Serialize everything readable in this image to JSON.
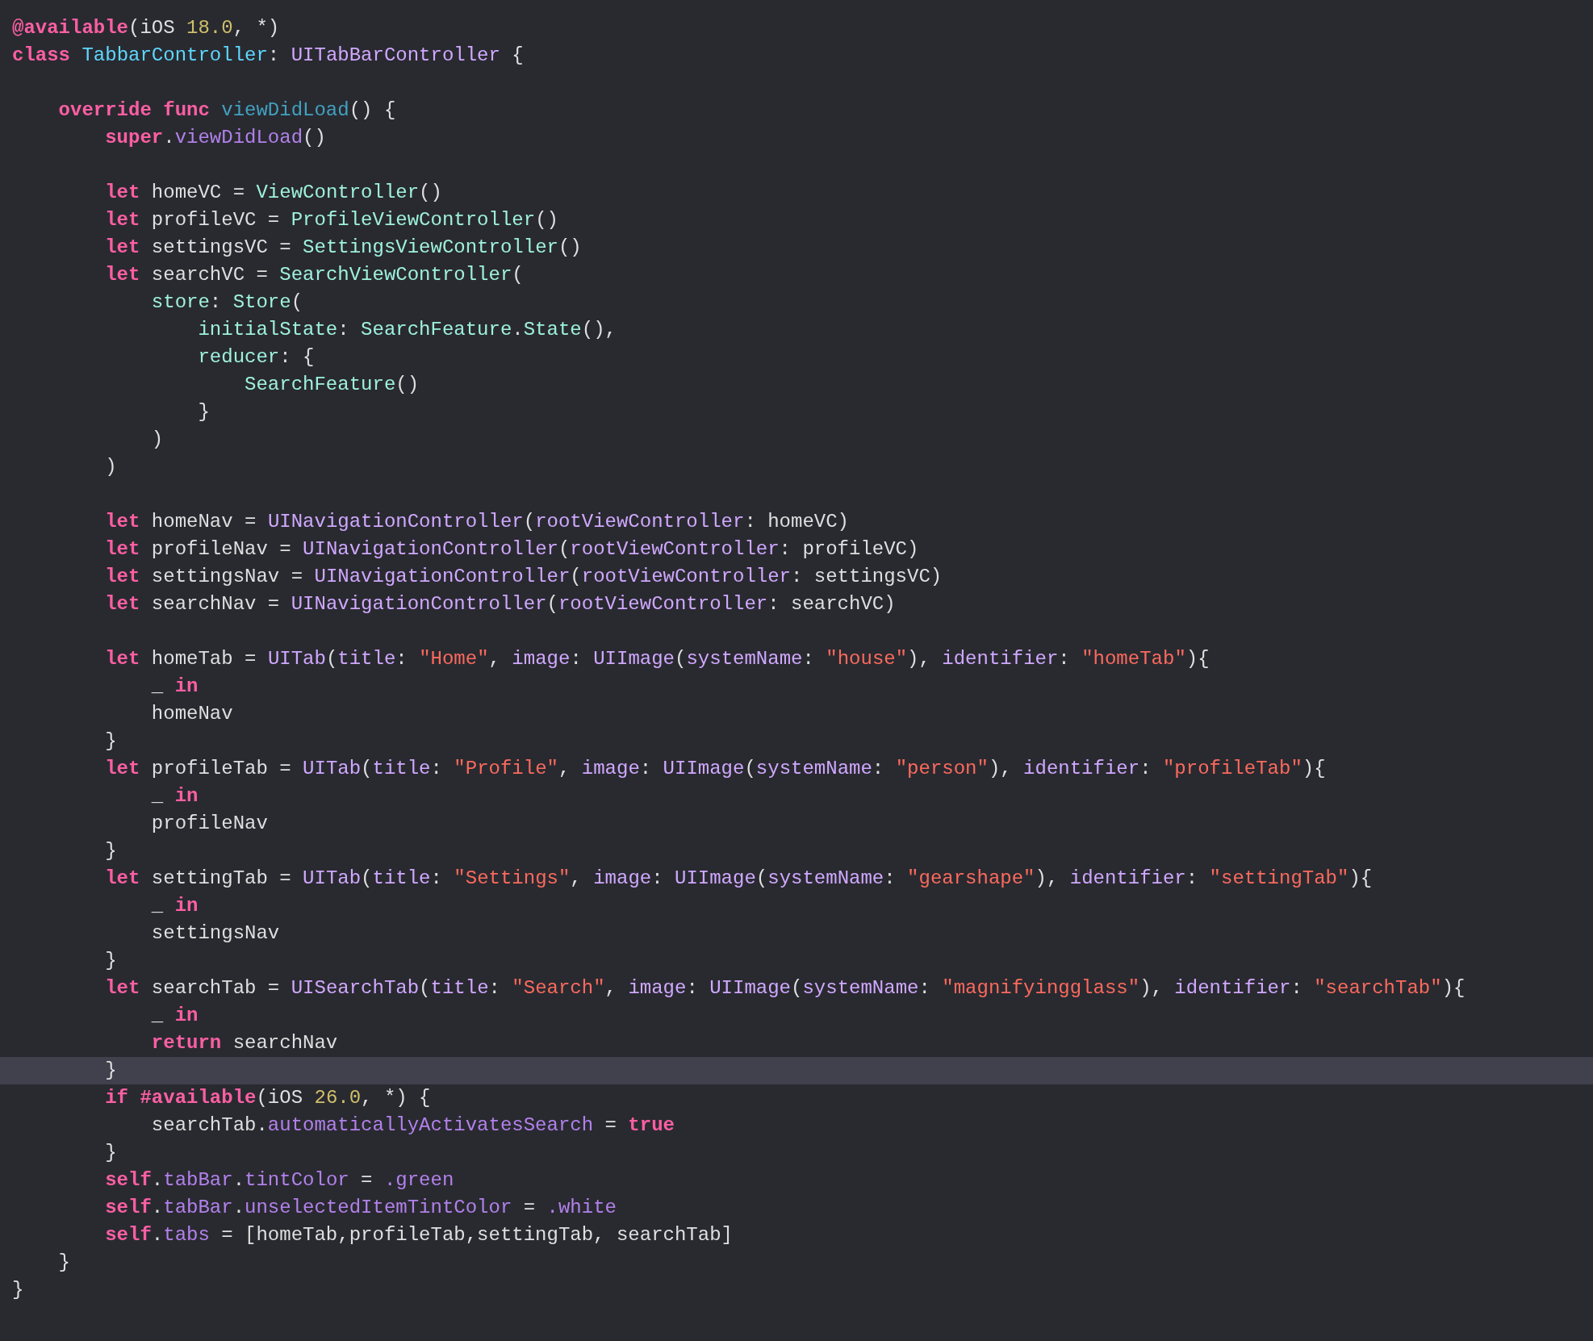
{
  "editor": {
    "lines": [
      {
        "kind": "code",
        "current": false,
        "tokens": [
          {
            "text": "@available",
            "kind": "kw"
          },
          {
            "text": "(iOS ",
            "kind": "plain"
          },
          {
            "text": "18.0",
            "kind": "num"
          },
          {
            "text": ", *)",
            "kind": "plain"
          }
        ]
      },
      {
        "kind": "code",
        "current": false,
        "tokens": [
          {
            "text": "class",
            "kind": "kw"
          },
          {
            "text": " TabbarController",
            "kind": "type"
          },
          {
            "text": ": ",
            "kind": "plain"
          },
          {
            "text": "UITabBarController",
            "kind": "sys"
          },
          {
            "text": " {",
            "kind": "plain"
          }
        ],
        "children": [
          {
            "kind": "blank"
          },
          {
            "kind": "code",
            "current": false,
            "tokens": [
              {
                "text": "override func",
                "kind": "kw"
              },
              {
                "text": " viewDidLoad",
                "kind": "fdecl"
              },
              {
                "text": "() {",
                "kind": "plain"
              }
            ],
            "children": [
              {
                "kind": "code",
                "current": false,
                "tokens": [
                  {
                    "text": "super",
                    "kind": "kw"
                  },
                  {
                    "text": ".",
                    "kind": "plain"
                  },
                  {
                    "text": "viewDidLoad",
                    "kind": "sysm"
                  },
                  {
                    "text": "()",
                    "kind": "plain"
                  }
                ]
              },
              {
                "kind": "blank"
              },
              {
                "kind": "code",
                "current": false,
                "tokens": [
                  {
                    "text": "let",
                    "kind": "kw"
                  },
                  {
                    "text": " homeVC = ",
                    "kind": "plain"
                  },
                  {
                    "text": "ViewController",
                    "kind": "proj"
                  },
                  {
                    "text": "()",
                    "kind": "plain"
                  }
                ]
              },
              {
                "kind": "code",
                "current": false,
                "tokens": [
                  {
                    "text": "let",
                    "kind": "kw"
                  },
                  {
                    "text": " profileVC = ",
                    "kind": "plain"
                  },
                  {
                    "text": "ProfileViewController",
                    "kind": "proj"
                  },
                  {
                    "text": "()",
                    "kind": "plain"
                  }
                ]
              },
              {
                "kind": "code",
                "current": false,
                "tokens": [
                  {
                    "text": "let",
                    "kind": "kw"
                  },
                  {
                    "text": " settingsVC = ",
                    "kind": "plain"
                  },
                  {
                    "text": "SettingsViewController",
                    "kind": "proj"
                  },
                  {
                    "text": "()",
                    "kind": "plain"
                  }
                ]
              },
              {
                "kind": "code",
                "current": false,
                "tokens": [
                  {
                    "text": "let",
                    "kind": "kw"
                  },
                  {
                    "text": " searchVC = ",
                    "kind": "plain"
                  },
                  {
                    "text": "SearchViewController",
                    "kind": "proj"
                  },
                  {
                    "text": "(",
                    "kind": "plain"
                  }
                ],
                "children": [
                  {
                    "kind": "code",
                    "current": false,
                    "tokens": [
                      {
                        "text": "store",
                        "kind": "proj"
                      },
                      {
                        "text": ": ",
                        "kind": "plain"
                      },
                      {
                        "text": "Store",
                        "kind": "proj"
                      },
                      {
                        "text": "(",
                        "kind": "plain"
                      }
                    ],
                    "children": [
                      {
                        "kind": "code",
                        "current": false,
                        "tokens": [
                          {
                            "text": "initialState",
                            "kind": "proj"
                          },
                          {
                            "text": ": ",
                            "kind": "plain"
                          },
                          {
                            "text": "SearchFeature",
                            "kind": "proj"
                          },
                          {
                            "text": ".",
                            "kind": "plain"
                          },
                          {
                            "text": "State",
                            "kind": "proj"
                          },
                          {
                            "text": "(),",
                            "kind": "plain"
                          }
                        ]
                      },
                      {
                        "kind": "code",
                        "current": false,
                        "tokens": [
                          {
                            "text": "reducer",
                            "kind": "proj"
                          },
                          {
                            "text": ": {",
                            "kind": "plain"
                          }
                        ],
                        "children": [
                          {
                            "kind": "code",
                            "current": false,
                            "tokens": [
                              {
                                "text": "SearchFeature",
                                "kind": "proj"
                              },
                              {
                                "text": "()",
                                "kind": "plain"
                              }
                            ]
                          }
                        ]
                      },
                      {
                        "kind": "code",
                        "current": false,
                        "tokens": [
                          {
                            "text": "}",
                            "kind": "plain"
                          }
                        ]
                      }
                    ]
                  },
                  {
                    "kind": "code",
                    "current": false,
                    "tokens": [
                      {
                        "text": ")",
                        "kind": "plain"
                      }
                    ]
                  }
                ]
              },
              {
                "kind": "code",
                "current": false,
                "tokens": [
                  {
                    "text": ")",
                    "kind": "plain"
                  }
                ]
              },
              {
                "kind": "blank"
              },
              {
                "kind": "code",
                "current": false,
                "tokens": [
                  {
                    "text": "let",
                    "kind": "kw"
                  },
                  {
                    "text": " homeNav = ",
                    "kind": "plain"
                  },
                  {
                    "text": "UINavigationController",
                    "kind": "sys"
                  },
                  {
                    "text": "(",
                    "kind": "plain"
                  },
                  {
                    "text": "rootViewController",
                    "kind": "sys"
                  },
                  {
                    "text": ": homeVC)",
                    "kind": "plain"
                  }
                ]
              },
              {
                "kind": "code",
                "current": false,
                "tokens": [
                  {
                    "text": "let",
                    "kind": "kw"
                  },
                  {
                    "text": " profileNav = ",
                    "kind": "plain"
                  },
                  {
                    "text": "UINavigationController",
                    "kind": "sys"
                  },
                  {
                    "text": "(",
                    "kind": "plain"
                  },
                  {
                    "text": "rootViewController",
                    "kind": "sys"
                  },
                  {
                    "text": ": profileVC)",
                    "kind": "plain"
                  }
                ]
              },
              {
                "kind": "code",
                "current": false,
                "tokens": [
                  {
                    "text": "let",
                    "kind": "kw"
                  },
                  {
                    "text": " settingsNav = ",
                    "kind": "plain"
                  },
                  {
                    "text": "UINavigationController",
                    "kind": "sys"
                  },
                  {
                    "text": "(",
                    "kind": "plain"
                  },
                  {
                    "text": "rootViewController",
                    "kind": "sys"
                  },
                  {
                    "text": ": settingsVC)",
                    "kind": "plain"
                  }
                ]
              },
              {
                "kind": "code",
                "current": false,
                "tokens": [
                  {
                    "text": "let",
                    "kind": "kw"
                  },
                  {
                    "text": " searchNav = ",
                    "kind": "plain"
                  },
                  {
                    "text": "UINavigationController",
                    "kind": "sys"
                  },
                  {
                    "text": "(",
                    "kind": "plain"
                  },
                  {
                    "text": "rootViewController",
                    "kind": "sys"
                  },
                  {
                    "text": ": searchVC)",
                    "kind": "plain"
                  }
                ]
              },
              {
                "kind": "blank"
              },
              {
                "kind": "code",
                "current": false,
                "tokens": [
                  {
                    "text": "let",
                    "kind": "kw"
                  },
                  {
                    "text": " homeTab = ",
                    "kind": "plain"
                  },
                  {
                    "text": "UITab",
                    "kind": "sys"
                  },
                  {
                    "text": "(",
                    "kind": "plain"
                  },
                  {
                    "text": "title",
                    "kind": "sys"
                  },
                  {
                    "text": ": ",
                    "kind": "plain"
                  },
                  {
                    "text": "\"Home\"",
                    "kind": "str"
                  },
                  {
                    "text": ", ",
                    "kind": "plain"
                  },
                  {
                    "text": "image",
                    "kind": "sys"
                  },
                  {
                    "text": ": ",
                    "kind": "plain"
                  },
                  {
                    "text": "UIImage",
                    "kind": "sys"
                  },
                  {
                    "text": "(",
                    "kind": "plain"
                  },
                  {
                    "text": "systemName",
                    "kind": "sys"
                  },
                  {
                    "text": ": ",
                    "kind": "plain"
                  },
                  {
                    "text": "\"house\"",
                    "kind": "str"
                  },
                  {
                    "text": "), ",
                    "kind": "plain"
                  },
                  {
                    "text": "identifier",
                    "kind": "sys"
                  },
                  {
                    "text": ": ",
                    "kind": "plain"
                  },
                  {
                    "text": "\"homeTab\"",
                    "kind": "str"
                  },
                  {
                    "text": "){",
                    "kind": "plain"
                  }
                ],
                "children": [
                  {
                    "kind": "code",
                    "current": false,
                    "tokens": [
                      {
                        "text": "_ ",
                        "kind": "plain"
                      },
                      {
                        "text": "in",
                        "kind": "kw"
                      }
                    ]
                  },
                  {
                    "kind": "code",
                    "current": false,
                    "tokens": [
                      {
                        "text": "homeNav",
                        "kind": "plain"
                      }
                    ]
                  }
                ]
              },
              {
                "kind": "code",
                "current": false,
                "tokens": [
                  {
                    "text": "}",
                    "kind": "plain"
                  }
                ]
              },
              {
                "kind": "code",
                "current": false,
                "tokens": [
                  {
                    "text": "let",
                    "kind": "kw"
                  },
                  {
                    "text": " profileTab = ",
                    "kind": "plain"
                  },
                  {
                    "text": "UITab",
                    "kind": "sys"
                  },
                  {
                    "text": "(",
                    "kind": "plain"
                  },
                  {
                    "text": "title",
                    "kind": "sys"
                  },
                  {
                    "text": ": ",
                    "kind": "plain"
                  },
                  {
                    "text": "\"Profile\"",
                    "kind": "str"
                  },
                  {
                    "text": ", ",
                    "kind": "plain"
                  },
                  {
                    "text": "image",
                    "kind": "sys"
                  },
                  {
                    "text": ": ",
                    "kind": "plain"
                  },
                  {
                    "text": "UIImage",
                    "kind": "sys"
                  },
                  {
                    "text": "(",
                    "kind": "plain"
                  },
                  {
                    "text": "systemName",
                    "kind": "sys"
                  },
                  {
                    "text": ": ",
                    "kind": "plain"
                  },
                  {
                    "text": "\"person\"",
                    "kind": "str"
                  },
                  {
                    "text": "), ",
                    "kind": "plain"
                  },
                  {
                    "text": "identifier",
                    "kind": "sys"
                  },
                  {
                    "text": ": ",
                    "kind": "plain"
                  },
                  {
                    "text": "\"profileTab\"",
                    "kind": "str"
                  },
                  {
                    "text": "){",
                    "kind": "plain"
                  }
                ],
                "children": [
                  {
                    "kind": "code",
                    "current": false,
                    "tokens": [
                      {
                        "text": "_ ",
                        "kind": "plain"
                      },
                      {
                        "text": "in",
                        "kind": "kw"
                      }
                    ]
                  },
                  {
                    "kind": "code",
                    "current": false,
                    "tokens": [
                      {
                        "text": "profileNav",
                        "kind": "plain"
                      }
                    ]
                  }
                ]
              },
              {
                "kind": "code",
                "current": false,
                "tokens": [
                  {
                    "text": "}",
                    "kind": "plain"
                  }
                ]
              },
              {
                "kind": "code",
                "current": false,
                "tokens": [
                  {
                    "text": "let",
                    "kind": "kw"
                  },
                  {
                    "text": " settingTab = ",
                    "kind": "plain"
                  },
                  {
                    "text": "UITab",
                    "kind": "sys"
                  },
                  {
                    "text": "(",
                    "kind": "plain"
                  },
                  {
                    "text": "title",
                    "kind": "sys"
                  },
                  {
                    "text": ": ",
                    "kind": "plain"
                  },
                  {
                    "text": "\"Settings\"",
                    "kind": "str"
                  },
                  {
                    "text": ", ",
                    "kind": "plain"
                  },
                  {
                    "text": "image",
                    "kind": "sys"
                  },
                  {
                    "text": ": ",
                    "kind": "plain"
                  },
                  {
                    "text": "UIImage",
                    "kind": "sys"
                  },
                  {
                    "text": "(",
                    "kind": "plain"
                  },
                  {
                    "text": "systemName",
                    "kind": "sys"
                  },
                  {
                    "text": ": ",
                    "kind": "plain"
                  },
                  {
                    "text": "\"gearshape\"",
                    "kind": "str"
                  },
                  {
                    "text": "), ",
                    "kind": "plain"
                  },
                  {
                    "text": "identifier",
                    "kind": "sys"
                  },
                  {
                    "text": ": ",
                    "kind": "plain"
                  },
                  {
                    "text": "\"settingTab\"",
                    "kind": "str"
                  },
                  {
                    "text": "){",
                    "kind": "plain"
                  }
                ],
                "children": [
                  {
                    "kind": "code",
                    "current": false,
                    "tokens": [
                      {
                        "text": "_ ",
                        "kind": "plain"
                      },
                      {
                        "text": "in",
                        "kind": "kw"
                      }
                    ]
                  },
                  {
                    "kind": "code",
                    "current": false,
                    "tokens": [
                      {
                        "text": "settingsNav",
                        "kind": "plain"
                      }
                    ]
                  }
                ]
              },
              {
                "kind": "code",
                "current": false,
                "tokens": [
                  {
                    "text": "}",
                    "kind": "plain"
                  }
                ]
              },
              {
                "kind": "code",
                "current": false,
                "tokens": [
                  {
                    "text": "let",
                    "kind": "kw"
                  },
                  {
                    "text": " searchTab = ",
                    "kind": "plain"
                  },
                  {
                    "text": "UISearchTab",
                    "kind": "sys"
                  },
                  {
                    "text": "(",
                    "kind": "plain"
                  },
                  {
                    "text": "title",
                    "kind": "sys"
                  },
                  {
                    "text": ": ",
                    "kind": "plain"
                  },
                  {
                    "text": "\"Search\"",
                    "kind": "str"
                  },
                  {
                    "text": ", ",
                    "kind": "plain"
                  },
                  {
                    "text": "image",
                    "kind": "sys"
                  },
                  {
                    "text": ": ",
                    "kind": "plain"
                  },
                  {
                    "text": "UIImage",
                    "kind": "sys"
                  },
                  {
                    "text": "(",
                    "kind": "plain"
                  },
                  {
                    "text": "systemName",
                    "kind": "sys"
                  },
                  {
                    "text": ": ",
                    "kind": "plain"
                  },
                  {
                    "text": "\"magnifyingglass\"",
                    "kind": "str"
                  },
                  {
                    "text": "), ",
                    "kind": "plain"
                  },
                  {
                    "text": "identifier",
                    "kind": "sys"
                  },
                  {
                    "text": ": ",
                    "kind": "plain"
                  },
                  {
                    "text": "\"searchTab\"",
                    "kind": "str"
                  },
                  {
                    "text": "){",
                    "kind": "plain"
                  }
                ],
                "children": [
                  {
                    "kind": "code",
                    "current": false,
                    "tokens": [
                      {
                        "text": "_ ",
                        "kind": "plain"
                      },
                      {
                        "text": "in",
                        "kind": "kw"
                      }
                    ]
                  },
                  {
                    "kind": "code",
                    "current": false,
                    "tokens": [
                      {
                        "text": "return",
                        "kind": "kw"
                      },
                      {
                        "text": " searchNav",
                        "kind": "plain"
                      }
                    ]
                  }
                ]
              },
              {
                "kind": "code",
                "current": true,
                "tokens": [
                  {
                    "text": "}",
                    "kind": "plain"
                  }
                ]
              },
              {
                "kind": "code",
                "current": false,
                "tokens": [
                  {
                    "text": "if",
                    "kind": "kw"
                  },
                  {
                    "text": " #available",
                    "kind": "kw"
                  },
                  {
                    "text": "(iOS ",
                    "kind": "plain"
                  },
                  {
                    "text": "26.0",
                    "kind": "num"
                  },
                  {
                    "text": ", *) {",
                    "kind": "plain"
                  }
                ],
                "children": [
                  {
                    "kind": "code",
                    "current": false,
                    "tokens": [
                      {
                        "text": "searchTab.",
                        "kind": "plain"
                      },
                      {
                        "text": "automaticallyActivatesSearch",
                        "kind": "sysm"
                      },
                      {
                        "text": " = ",
                        "kind": "plain"
                      },
                      {
                        "text": "true",
                        "kind": "kw"
                      }
                    ]
                  }
                ]
              },
              {
                "kind": "code",
                "current": false,
                "tokens": [
                  {
                    "text": "}",
                    "kind": "plain"
                  }
                ]
              },
              {
                "kind": "code",
                "current": false,
                "tokens": [
                  {
                    "text": "self",
                    "kind": "kw"
                  },
                  {
                    "text": ".",
                    "kind": "plain"
                  },
                  {
                    "text": "tabBar",
                    "kind": "sysm"
                  },
                  {
                    "text": ".",
                    "kind": "plain"
                  },
                  {
                    "text": "tintColor",
                    "kind": "sysm"
                  },
                  {
                    "text": " = ",
                    "kind": "plain"
                  },
                  {
                    "text": ".green",
                    "kind": "sysm"
                  }
                ]
              },
              {
                "kind": "code",
                "current": false,
                "tokens": [
                  {
                    "text": "self",
                    "kind": "kw"
                  },
                  {
                    "text": ".",
                    "kind": "plain"
                  },
                  {
                    "text": "tabBar",
                    "kind": "sysm"
                  },
                  {
                    "text": ".",
                    "kind": "plain"
                  },
                  {
                    "text": "unselectedItemTintColor",
                    "kind": "sysm"
                  },
                  {
                    "text": " = ",
                    "kind": "plain"
                  },
                  {
                    "text": ".white",
                    "kind": "sysm"
                  }
                ]
              },
              {
                "kind": "code",
                "current": false,
                "tokens": [
                  {
                    "text": "self",
                    "kind": "kw"
                  },
                  {
                    "text": ".",
                    "kind": "plain"
                  },
                  {
                    "text": "tabs",
                    "kind": "sysm"
                  },
                  {
                    "text": " = [homeTab,profileTab,settingTab, searchTab]",
                    "kind": "plain"
                  }
                ]
              }
            ]
          },
          {
            "kind": "code",
            "current": false,
            "tokens": [
              {
                "text": "}",
                "kind": "plain"
              }
            ]
          }
        ]
      },
      {
        "kind": "code",
        "current": false,
        "tokens": [
          {
            "text": "}",
            "kind": "plain"
          }
        ]
      }
    ]
  }
}
